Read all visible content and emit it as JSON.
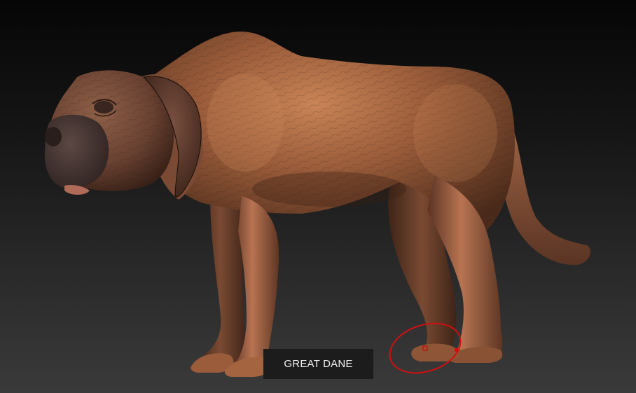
{
  "viewport": {
    "background_top": "#060606",
    "background_bottom": "#3a3a3a"
  },
  "model": {
    "subject": "great-dane-sculpt",
    "skin_color": "#8a5234",
    "skin_highlight": "#c07a50",
    "skin_shadow": "#3f2418",
    "muzzle_color": "#4a3a36"
  },
  "label": {
    "text": "GREAT DANE"
  },
  "brush_cursor": {
    "color": "#d01010"
  }
}
